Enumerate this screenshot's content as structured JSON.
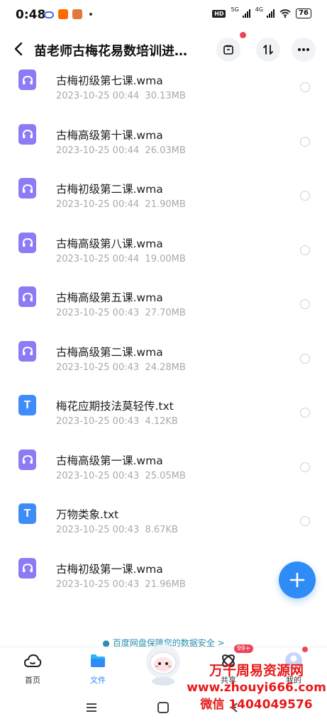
{
  "status_bar": {
    "time": "0:48",
    "hd": "HD",
    "net1": "5G",
    "net2": "4G",
    "battery": "76"
  },
  "header": {
    "title": "苗老师古梅花易数培训进…"
  },
  "files": [
    {
      "name": "古梅初级第七课.wma",
      "date": "2023-10-25  00:44",
      "size": "30.13MB",
      "type": "audio"
    },
    {
      "name": "古梅高级第十课.wma",
      "date": "2023-10-25  00:44",
      "size": "26.03MB",
      "type": "audio"
    },
    {
      "name": "古梅初级第二课.wma",
      "date": "2023-10-25  00:44",
      "size": "21.90MB",
      "type": "audio"
    },
    {
      "name": "古梅高级第八课.wma",
      "date": "2023-10-25  00:44",
      "size": "19.00MB",
      "type": "audio"
    },
    {
      "name": "古梅高级第五课.wma",
      "date": "2023-10-25  00:43",
      "size": "27.70MB",
      "type": "audio"
    },
    {
      "name": "古梅高级第二课.wma",
      "date": "2023-10-25  00:43",
      "size": "24.28MB",
      "type": "audio"
    },
    {
      "name": "梅花应期技法莫轻传.txt",
      "date": "2023-10-25  00:43",
      "size": "4.12KB",
      "type": "text"
    },
    {
      "name": "古梅高级第一课.wma",
      "date": "2023-10-25  00:43",
      "size": "25.05MB",
      "type": "audio"
    },
    {
      "name": "万物类象.txt",
      "date": "2023-10-25  00:43",
      "size": "8.67KB",
      "type": "text"
    },
    {
      "name": "古梅初级第一课.wma",
      "date": "2023-10-25  00:43",
      "size": "21.96MB",
      "type": "audio"
    }
  ],
  "text_icon_letter": "T",
  "banner": "百度网盘保障您的数据安全 >",
  "bottom_nav": {
    "home": "首页",
    "files": "文件",
    "share": "共享",
    "mine": "我的",
    "share_badge": "99+"
  },
  "watermark": {
    "line1": "万千周易资源网",
    "line2": "www.zhouyi666.com",
    "line3": "微信 1404049576"
  },
  "colors": {
    "accent": "#2f8cf7",
    "audio_icon": "#8b7cf6",
    "text_icon": "#3d8cf7",
    "badge": "#f0435a",
    "watermark": "#e81919"
  }
}
